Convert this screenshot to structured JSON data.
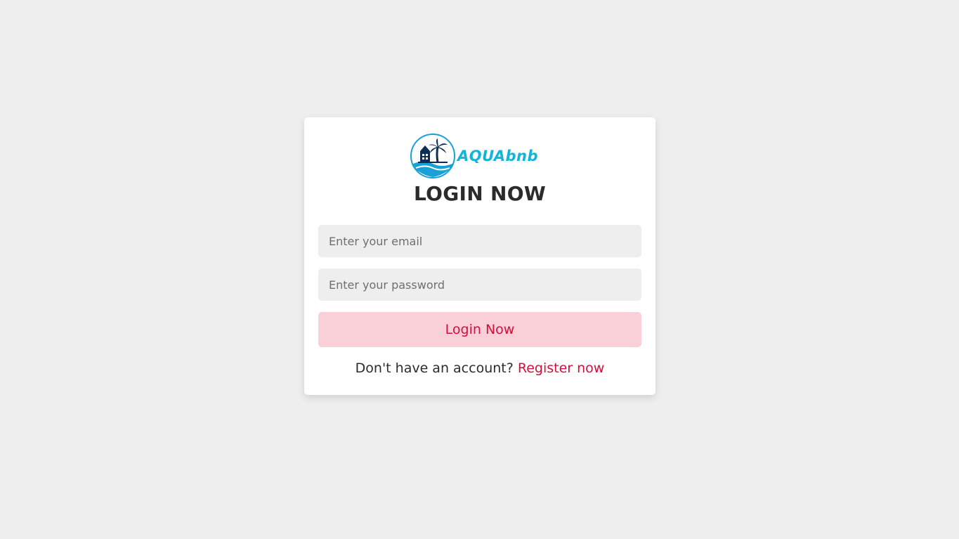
{
  "brand": {
    "name": "AQUAbnb",
    "color": "#13b4d9",
    "icon": "beach-house-palm-logo"
  },
  "form": {
    "title": "LOGIN NOW",
    "email_placeholder": "Enter your email",
    "password_placeholder": "Enter your password",
    "submit_label": "Login Now",
    "register_prompt": "Don't have an account?",
    "register_link": "Register now"
  },
  "colors": {
    "page_background": "#eeeeee",
    "accent": "#d20f3c",
    "button_background": "#fad0d8"
  }
}
